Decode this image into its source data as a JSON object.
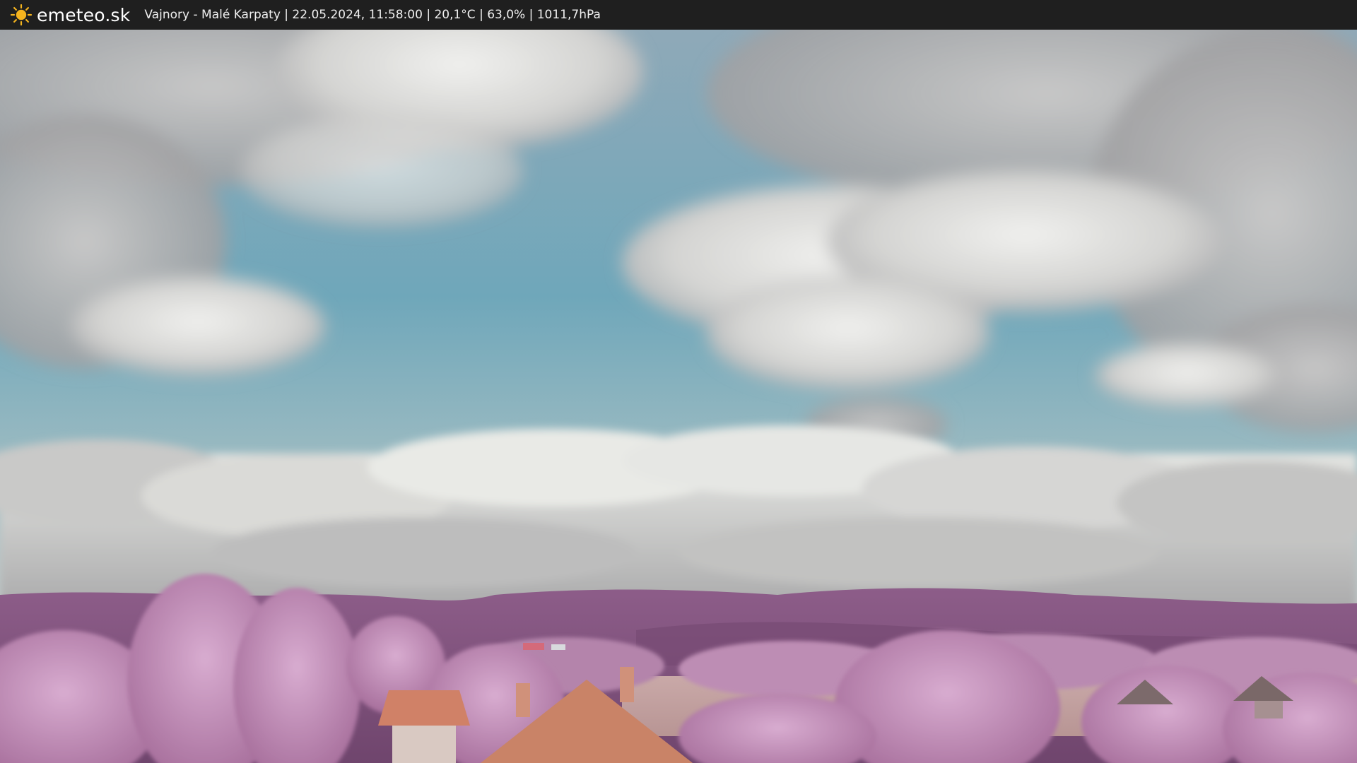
{
  "header": {
    "brand": "emeteo.sk",
    "logo_icon": "sun-icon",
    "caption": "Vajnory - Malé Karpaty | 22.05.2024, 11:58:00 | 20,1°C | 63,0% | 1011,7hPa"
  },
  "colors": {
    "bar_background": "#1f1f1f",
    "sun": "#f5b41e",
    "sky": "#6fa7ba",
    "cloud": "#d9d9d6",
    "hills": "#8a5a86",
    "foliage": "#c79ac0",
    "roof": "#d4876a"
  }
}
